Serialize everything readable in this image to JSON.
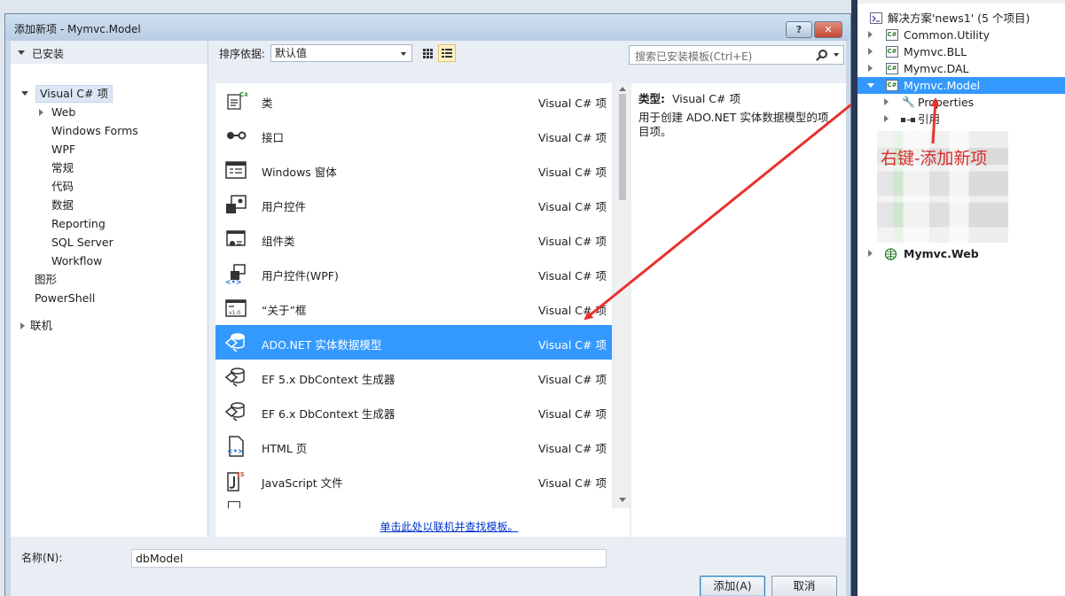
{
  "dialog": {
    "title": "添加新项 - Mymvc.Model",
    "help_glyph": "?",
    "close_glyph": "✕"
  },
  "left_tree": {
    "installed_header": "已安装",
    "root": "Visual C# 项",
    "children": [
      "Web",
      "Windows Forms",
      "WPF",
      "常规",
      "代码",
      "数据",
      "Reporting",
      "SQL Server",
      "Workflow"
    ],
    "siblings": [
      "图形",
      "PowerShell"
    ],
    "online": "联机"
  },
  "sort": {
    "label": "排序依据:",
    "value": "默认值"
  },
  "search": {
    "placeholder": "搜索已安装模板(Ctrl+E)"
  },
  "items": [
    {
      "name": "类",
      "type": "Visual C# 项",
      "icon": "class-icon"
    },
    {
      "name": "接口",
      "type": "Visual C# 项",
      "icon": "interface-icon"
    },
    {
      "name": "Windows 窗体",
      "type": "Visual C# 项",
      "icon": "windows-form-icon"
    },
    {
      "name": "用户控件",
      "type": "Visual C# 项",
      "icon": "user-control-icon"
    },
    {
      "name": "组件类",
      "type": "Visual C# 项",
      "icon": "component-class-icon"
    },
    {
      "name": "用户控件(WPF)",
      "type": "Visual C# 项",
      "icon": "wpf-user-control-icon"
    },
    {
      "name": "“关于”框",
      "type": "Visual C# 项",
      "icon": "about-box-icon"
    },
    {
      "name": "ADO.NET 实体数据模型",
      "type": "Visual C# 项",
      "icon": "entity-model-icon",
      "selected": true
    },
    {
      "name": "EF 5.x DbContext 生成器",
      "type": "Visual C# 项",
      "icon": "entity-model-icon"
    },
    {
      "name": "EF 6.x DbContext 生成器",
      "type": "Visual C# 项",
      "icon": "entity-model-icon"
    },
    {
      "name": "HTML 页",
      "type": "Visual C# 项",
      "icon": "html-page-icon"
    },
    {
      "name": "JavaScript 文件",
      "type": "Visual C# 项",
      "icon": "javascript-file-icon"
    }
  ],
  "online_link": "单击此处以联机并查找模板。",
  "detail": {
    "type_label": "类型:",
    "type_value": "Visual C# 项",
    "description": "用于创建 ADO.NET 实体数据模型的项目项。"
  },
  "name_field": {
    "label": "名称(N):",
    "value": "dbModel"
  },
  "buttons": {
    "add": "添加(A)",
    "cancel": "取消"
  },
  "solution_explorer": {
    "solution": "解决方案'news1' (5 个项目)",
    "projects": [
      "Common.Utility",
      "Mymvc.BLL",
      "Mymvc.DAL",
      "Mymvc.Model"
    ],
    "model_children": [
      "Properties",
      "引用"
    ],
    "web_project": "Mymvc.Web",
    "cs_tag": "C#"
  },
  "annotation": "右键-添加新项",
  "colors": {
    "selection": "#3399ff",
    "annotation_red": "#e8322d"
  }
}
